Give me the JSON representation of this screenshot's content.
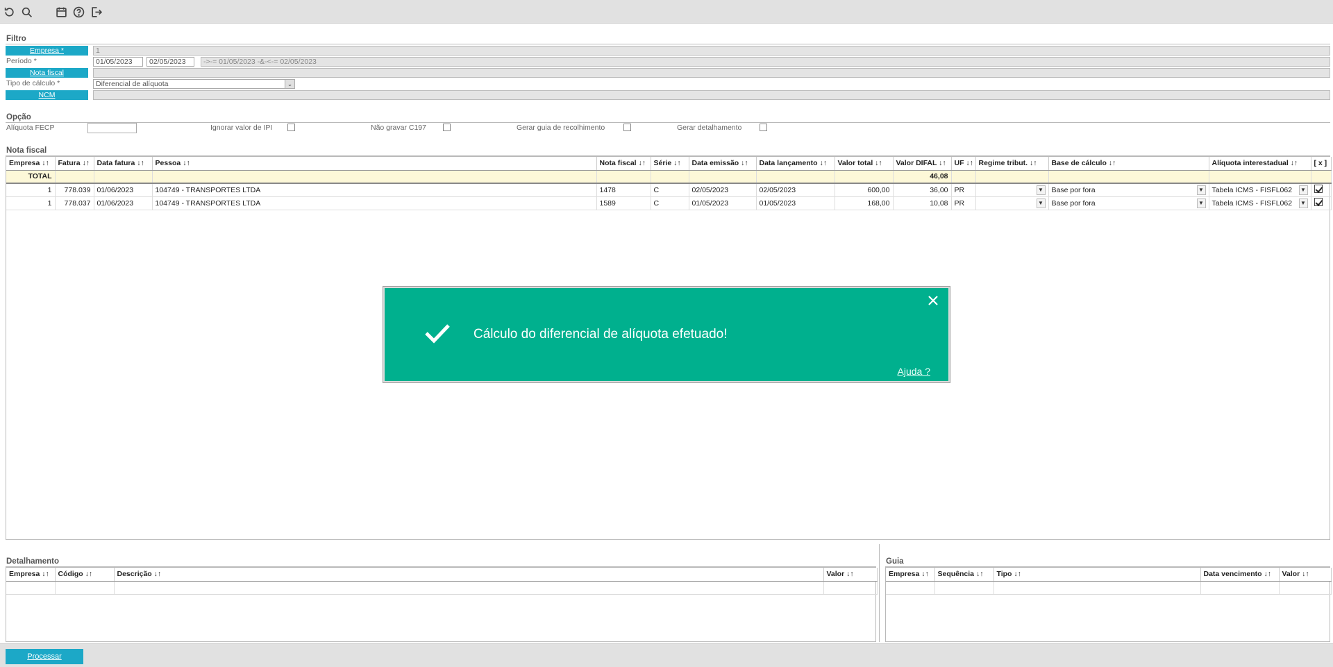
{
  "toolbar": {
    "icons": [
      "refresh-icon",
      "search-icon",
      "calendar-icon",
      "help-icon",
      "logout-icon"
    ]
  },
  "filtro": {
    "title": "Filtro",
    "empresa_label": "Empresa *",
    "empresa_value": "1",
    "periodo_label": "Período *",
    "periodo_from": "01/05/2023",
    "periodo_to": "02/05/2023",
    "periodo_expr": "->-= 01/05/2023 -&-<-= 02/05/2023",
    "nota_label": "Nota fiscal",
    "tipo_label": "Tipo de cálculo *",
    "tipo_value": "Diferencial de alíquota",
    "ncm_label": "NCM"
  },
  "opcao": {
    "title": "Opção",
    "aliquota_label": "Alíquota FECP",
    "aliquota_value": "",
    "ignorar_ipi": "Ignorar valor de IPI",
    "nao_gravar": "Não gravar C197",
    "gerar_guia": "Gerar guia de recolhimento",
    "gerar_detalhamento": "Gerar detalhamento"
  },
  "nota": {
    "title": "Nota fiscal",
    "headers": [
      "Empresa ↓↑",
      "Fatura ↓↑",
      "Data fatura ↓↑",
      "Pessoa ↓↑",
      "Nota fiscal ↓↑",
      "Série ↓↑",
      "Data emissão ↓↑",
      "Data lançamento ↓↑",
      "Valor total ↓↑",
      "Valor DIFAL ↓↑",
      "UF ↓↑",
      "Regime tribut. ↓↑",
      "Base de cálculo ↓↑",
      "Alíquota interestadual ↓↑",
      "[ x ]"
    ],
    "total_label": "TOTAL",
    "total_difal": "46,08",
    "rows": [
      {
        "empresa": "1",
        "fatura": "778.039",
        "data_fatura": "01/06/2023",
        "pessoa": "104749 - TRANSPORTES LTDA",
        "nota": "1478",
        "serie": "C",
        "emissao": "02/05/2023",
        "lancamento": "02/05/2023",
        "total": "600,00",
        "difal": "36,00",
        "uf": "PR",
        "regime": "",
        "base": "Base por fora",
        "aliquota": "Tabela ICMS - FISFL062"
      },
      {
        "empresa": "1",
        "fatura": "778.037",
        "data_fatura": "01/06/2023",
        "pessoa": "104749 - TRANSPORTES LTDA",
        "nota": "1589",
        "serie": "C",
        "emissao": "01/05/2023",
        "lancamento": "01/05/2023",
        "total": "168,00",
        "difal": "10,08",
        "uf": "PR",
        "regime": "",
        "base": "Base por fora",
        "aliquota": "Tabela ICMS - FISFL062"
      }
    ]
  },
  "detalhamento": {
    "title": "Detalhamento",
    "headers": [
      "Empresa ↓↑",
      "Código ↓↑",
      "Descrição ↓↑",
      "Valor ↓↑"
    ]
  },
  "guia": {
    "title": "Guia",
    "headers": [
      "Empresa ↓↑",
      "Sequência ↓↑",
      "Tipo ↓↑",
      "Data vencimento ↓↑",
      "Valor ↓↑"
    ]
  },
  "footer": {
    "processar": "Processar"
  },
  "toast": {
    "message": "Cálculo do diferencial de alíquota efetuado!",
    "help_link": "Ajuda ?",
    "color": "#00b08e"
  }
}
